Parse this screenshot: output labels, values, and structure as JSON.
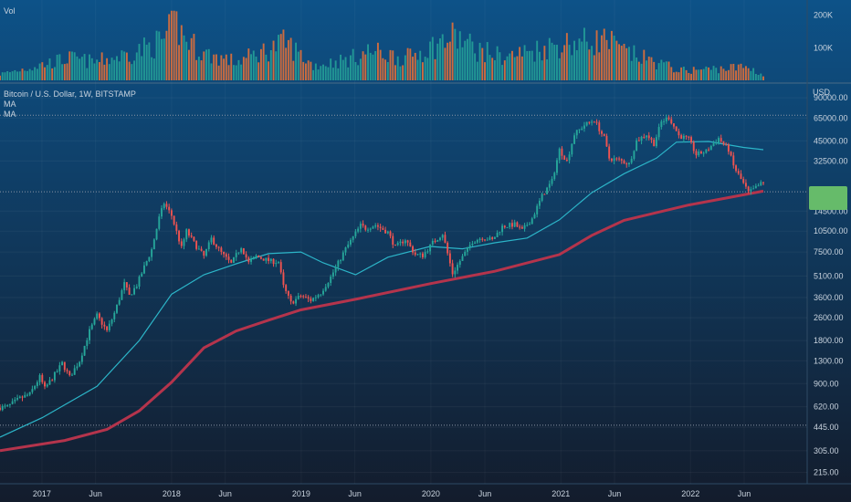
{
  "volume_pane": {
    "label": "Vol",
    "ticks": [
      {
        "label": "200K",
        "value": 200000
      },
      {
        "label": "100K",
        "value": 100000
      }
    ]
  },
  "price_pane": {
    "title": "Bitcoin / U.S. Dollar, 1W, BITSTAMP",
    "ma_labels": [
      "MA",
      "MA"
    ],
    "currency_label": "USD",
    "price_tag_color": "#66bb6a"
  },
  "colors": {
    "background_top": "#0d5288",
    "background_bottom": "#131c2c",
    "up": "#26a69a",
    "down": "#ef5350",
    "vol_up": "#26a69a",
    "vol_down": "#f07234",
    "ma_fast": "#2cb5c8",
    "ma_slow": "#b4344c",
    "axis_text": "#c9d3de",
    "dotted_line": "#8a95a5"
  },
  "chart_data": {
    "type": "candlestick",
    "symbol": "Bitcoin / U.S. Dollar",
    "interval": "1W",
    "exchange": "BITSTAMP",
    "y_scale": "log",
    "ylim": [
      190,
      100000
    ],
    "y_ticks": [
      {
        "label": "90000.00",
        "value": 90000
      },
      {
        "label": "65000.00",
        "value": 65000
      },
      {
        "label": "45000.00",
        "value": 45000
      },
      {
        "label": "32500.00",
        "value": 32500
      },
      {
        "label": "14500.00",
        "value": 14500
      },
      {
        "label": "10500.00",
        "value": 10500
      },
      {
        "label": "7500.00",
        "value": 7500
      },
      {
        "label": "5100.00",
        "value": 5100
      },
      {
        "label": "3600.00",
        "value": 3600
      },
      {
        "label": "2600.00",
        "value": 2600
      },
      {
        "label": "1800.00",
        "value": 1800
      },
      {
        "label": "1300.00",
        "value": 1300
      },
      {
        "label": "900.00",
        "value": 900
      },
      {
        "label": "620.00",
        "value": 620
      },
      {
        "label": "445.00",
        "value": 445
      },
      {
        "label": "305.00",
        "value": 305
      },
      {
        "label": "215.00",
        "value": 215
      }
    ],
    "x_range": [
      "2016-09-05",
      "2022-07-25"
    ],
    "x_ticks": [
      {
        "label": "2017",
        "date": "2017-01-01"
      },
      {
        "label": "Jun",
        "date": "2017-06-01"
      },
      {
        "label": "2018",
        "date": "2018-01-01"
      },
      {
        "label": "Jun",
        "date": "2018-06-01"
      },
      {
        "label": "2019",
        "date": "2019-01-01"
      },
      {
        "label": "Jun",
        "date": "2019-06-01"
      },
      {
        "label": "2020",
        "date": "2020-01-01"
      },
      {
        "label": "Jun",
        "date": "2020-06-01"
      },
      {
        "label": "2021",
        "date": "2021-01-01"
      },
      {
        "label": "Jun",
        "date": "2021-06-01"
      },
      {
        "label": "2022",
        "date": "2022-01-01"
      },
      {
        "label": "Jun",
        "date": "2022-06-01"
      }
    ],
    "price_path": [
      [
        "2016-09-05",
        610
      ],
      [
        "2016-10-03",
        620
      ],
      [
        "2016-11-07",
        710
      ],
      [
        "2016-12-05",
        760
      ],
      [
        "2017-01-02",
        1000
      ],
      [
        "2017-01-16",
        830
      ],
      [
        "2017-02-20",
        1100
      ],
      [
        "2017-03-06",
        1250
      ],
      [
        "2017-03-27",
        1000
      ],
      [
        "2017-04-24",
        1300
      ],
      [
        "2017-05-22",
        2100
      ],
      [
        "2017-06-12",
        2700
      ],
      [
        "2017-07-10",
        2100
      ],
      [
        "2017-07-31",
        2800
      ],
      [
        "2017-08-28",
        4500
      ],
      [
        "2017-09-11",
        3700
      ],
      [
        "2017-10-02",
        4400
      ],
      [
        "2017-10-23",
        5900
      ],
      [
        "2017-11-13",
        7800
      ],
      [
        "2017-12-04",
        13000
      ],
      [
        "2017-12-18",
        16500
      ],
      [
        "2018-01-08",
        13500
      ],
      [
        "2018-02-05",
        8000
      ],
      [
        "2018-02-19",
        10500
      ],
      [
        "2018-03-19",
        8200
      ],
      [
        "2018-04-09",
        7000
      ],
      [
        "2018-04-30",
        9300
      ],
      [
        "2018-05-28",
        7400
      ],
      [
        "2018-06-25",
        6200
      ],
      [
        "2018-07-23",
        8200
      ],
      [
        "2018-08-13",
        6300
      ],
      [
        "2018-09-03",
        7000
      ],
      [
        "2018-10-15",
        6450
      ],
      [
        "2018-11-05",
        6400
      ],
      [
        "2018-11-19",
        4300
      ],
      [
        "2018-12-10",
        3300
      ],
      [
        "2019-01-07",
        3700
      ],
      [
        "2019-02-04",
        3450
      ],
      [
        "2019-03-04",
        3900
      ],
      [
        "2019-04-01",
        5000
      ],
      [
        "2019-05-13",
        7900
      ],
      [
        "2019-06-24",
        11500
      ],
      [
        "2019-07-08",
        11000
      ],
      [
        "2019-08-05",
        11600
      ],
      [
        "2019-09-09",
        10300
      ],
      [
        "2019-09-30",
        8100
      ],
      [
        "2019-10-28",
        9200
      ],
      [
        "2019-11-25",
        7200
      ],
      [
        "2019-12-16",
        7100
      ],
      [
        "2020-01-13",
        8700
      ],
      [
        "2020-02-10",
        10100
      ],
      [
        "2020-03-09",
        5300
      ],
      [
        "2020-03-30",
        6500
      ],
      [
        "2020-05-04",
        8900
      ],
      [
        "2020-06-01",
        9500
      ],
      [
        "2020-06-29",
        9100
      ],
      [
        "2020-07-27",
        11300
      ],
      [
        "2020-08-31",
        11700
      ],
      [
        "2020-09-21",
        10600
      ],
      [
        "2020-10-19",
        12900
      ],
      [
        "2020-11-16",
        18500
      ],
      [
        "2020-12-14",
        23500
      ],
      [
        "2021-01-04",
        39000
      ],
      [
        "2021-01-25",
        32500
      ],
      [
        "2021-02-15",
        50000
      ],
      [
        "2021-03-15",
        58000
      ],
      [
        "2021-04-12",
        63000
      ],
      [
        "2021-05-10",
        47000
      ],
      [
        "2021-05-24",
        34000
      ],
      [
        "2021-06-21",
        33000
      ],
      [
        "2021-07-19",
        31000
      ],
      [
        "2021-08-09",
        45000
      ],
      [
        "2021-09-06",
        50000
      ],
      [
        "2021-09-27",
        43000
      ],
      [
        "2021-10-18",
        61000
      ],
      [
        "2021-11-08",
        66000
      ],
      [
        "2021-12-06",
        49000
      ],
      [
        "2022-01-03",
        46000
      ],
      [
        "2022-01-24",
        36000
      ],
      [
        "2022-02-21",
        38000
      ],
      [
        "2022-03-28",
        47000
      ],
      [
        "2022-04-25",
        39000
      ],
      [
        "2022-05-09",
        30000
      ],
      [
        "2022-06-13",
        21000
      ],
      [
        "2022-06-20",
        19500
      ],
      [
        "2022-07-04",
        20500
      ],
      [
        "2022-07-25",
        22500
      ]
    ],
    "ma_fast_path": [
      [
        "2016-09-05",
        380
      ],
      [
        "2017-01-02",
        520
      ],
      [
        "2017-06-05",
        860
      ],
      [
        "2017-10-02",
        1800
      ],
      [
        "2018-01-01",
        3800
      ],
      [
        "2018-04-02",
        5200
      ],
      [
        "2018-07-02",
        6200
      ],
      [
        "2018-10-01",
        7300
      ],
      [
        "2018-12-31",
        7500
      ],
      [
        "2019-03-04",
        6300
      ],
      [
        "2019-06-03",
        5200
      ],
      [
        "2019-09-02",
        6900
      ],
      [
        "2019-12-30",
        8200
      ],
      [
        "2020-03-30",
        7900
      ],
      [
        "2020-06-29",
        8700
      ],
      [
        "2020-09-28",
        9400
      ],
      [
        "2020-12-28",
        12600
      ],
      [
        "2021-03-29",
        19500
      ],
      [
        "2021-06-28",
        26500
      ],
      [
        "2021-09-27",
        34000
      ],
      [
        "2021-11-22",
        44000
      ],
      [
        "2022-02-21",
        44500
      ],
      [
        "2022-05-30",
        40500
      ],
      [
        "2022-07-25",
        39000
      ]
    ],
    "ma_slow_path": [
      [
        "2016-09-05",
        305
      ],
      [
        "2017-03-06",
        360
      ],
      [
        "2017-07-03",
        430
      ],
      [
        "2017-10-02",
        580
      ],
      [
        "2018-01-01",
        920
      ],
      [
        "2018-04-02",
        1600
      ],
      [
        "2018-07-02",
        2100
      ],
      [
        "2018-10-01",
        2500
      ],
      [
        "2018-12-31",
        2950
      ],
      [
        "2019-06-03",
        3500
      ],
      [
        "2019-12-30",
        4500
      ],
      [
        "2020-06-29",
        5500
      ],
      [
        "2020-12-28",
        7200
      ],
      [
        "2021-03-29",
        9800
      ],
      [
        "2021-06-28",
        12500
      ],
      [
        "2021-12-27",
        16000
      ],
      [
        "2022-07-25",
        20000
      ]
    ],
    "horizontal_levels": [
      {
        "value": 68000,
        "style": "dotted"
      },
      {
        "value": 19800,
        "style": "dotted"
      },
      {
        "value": 460,
        "style": "dotted"
      }
    ],
    "volume": {
      "ylim": [
        0,
        230000
      ],
      "peaks": [
        [
          "2016-09-05",
          25000
        ],
        [
          "2017-03-20",
          90000
        ],
        [
          "2017-05-29",
          75000
        ],
        [
          "2017-09-11",
          110000
        ],
        [
          "2017-12-04",
          160000
        ],
        [
          "2018-01-15",
          230000
        ],
        [
          "2018-02-05",
          175000
        ],
        [
          "2018-04-02",
          110000
        ],
        [
          "2018-07-02",
          75000
        ],
        [
          "2018-11-19",
          155000
        ],
        [
          "2019-02-04",
          60000
        ],
        [
          "2019-05-13",
          85000
        ],
        [
          "2019-07-15",
          120000
        ],
        [
          "2019-10-21",
          90000
        ],
        [
          "2020-03-09",
          180000
        ],
        [
          "2020-05-11",
          125000
        ],
        [
          "2020-07-27",
          95000
        ],
        [
          "2021-01-04",
          150000
        ],
        [
          "2021-05-10",
          165000
        ],
        [
          "2021-06-21",
          120000
        ],
        [
          "2021-12-06",
          40000
        ],
        [
          "2022-06-13",
          55000
        ],
        [
          "2022-07-25",
          20000
        ]
      ]
    }
  }
}
